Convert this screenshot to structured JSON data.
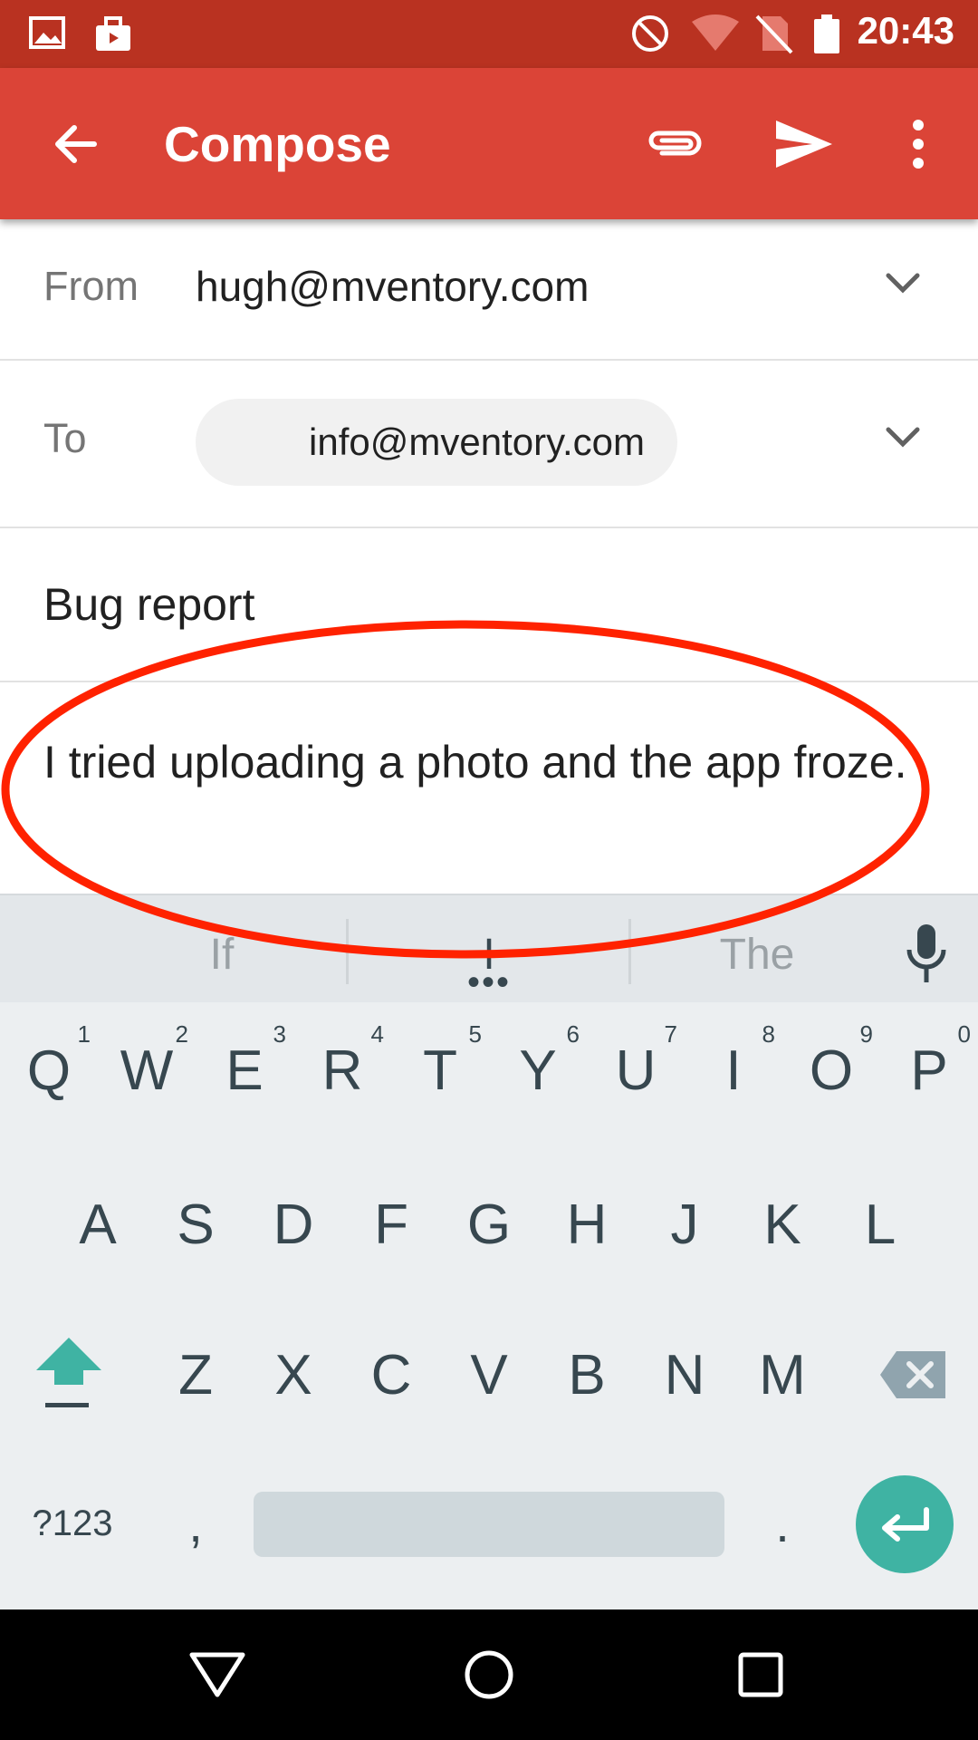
{
  "status_bar": {
    "time": "20:43",
    "icons": [
      "image-notification-icon",
      "briefcase-notification-icon",
      "do-not-disturb-icon",
      "wifi-icon",
      "no-sim-icon",
      "battery-icon"
    ],
    "color": "#b93221"
  },
  "app_bar": {
    "title": "Compose",
    "color": "#db4437",
    "icons": [
      "back-arrow-icon",
      "attach-icon",
      "send-icon",
      "more-vert-icon"
    ]
  },
  "from": {
    "label": "From",
    "value": "hugh@mventory.com"
  },
  "to": {
    "label": "To",
    "recipient": "info@mventory.com"
  },
  "subject": "Bug report",
  "body": "I tried uploading a photo and the app froze.",
  "annotation": {
    "shape": "ellipse",
    "color": "#ff2200"
  },
  "keyboard": {
    "suggestions": [
      "If",
      "I",
      "The"
    ],
    "row1": [
      {
        "letter": "Q",
        "num": "1"
      },
      {
        "letter": "W",
        "num": "2"
      },
      {
        "letter": "E",
        "num": "3"
      },
      {
        "letter": "R",
        "num": "4"
      },
      {
        "letter": "T",
        "num": "5"
      },
      {
        "letter": "Y",
        "num": "6"
      },
      {
        "letter": "U",
        "num": "7"
      },
      {
        "letter": "I",
        "num": "8"
      },
      {
        "letter": "O",
        "num": "9"
      },
      {
        "letter": "P",
        "num": "0"
      }
    ],
    "row2": [
      "A",
      "S",
      "D",
      "F",
      "G",
      "H",
      "J",
      "K",
      "L"
    ],
    "row3": [
      "Z",
      "X",
      "C",
      "V",
      "B",
      "N",
      "M"
    ],
    "symbols_key": "?123",
    "comma_key": ",",
    "period_key": ".",
    "accent": "#3fb3a3"
  },
  "nav_bar": {
    "icons": [
      "back-triangle-icon",
      "home-circle-icon",
      "recents-square-icon"
    ]
  }
}
